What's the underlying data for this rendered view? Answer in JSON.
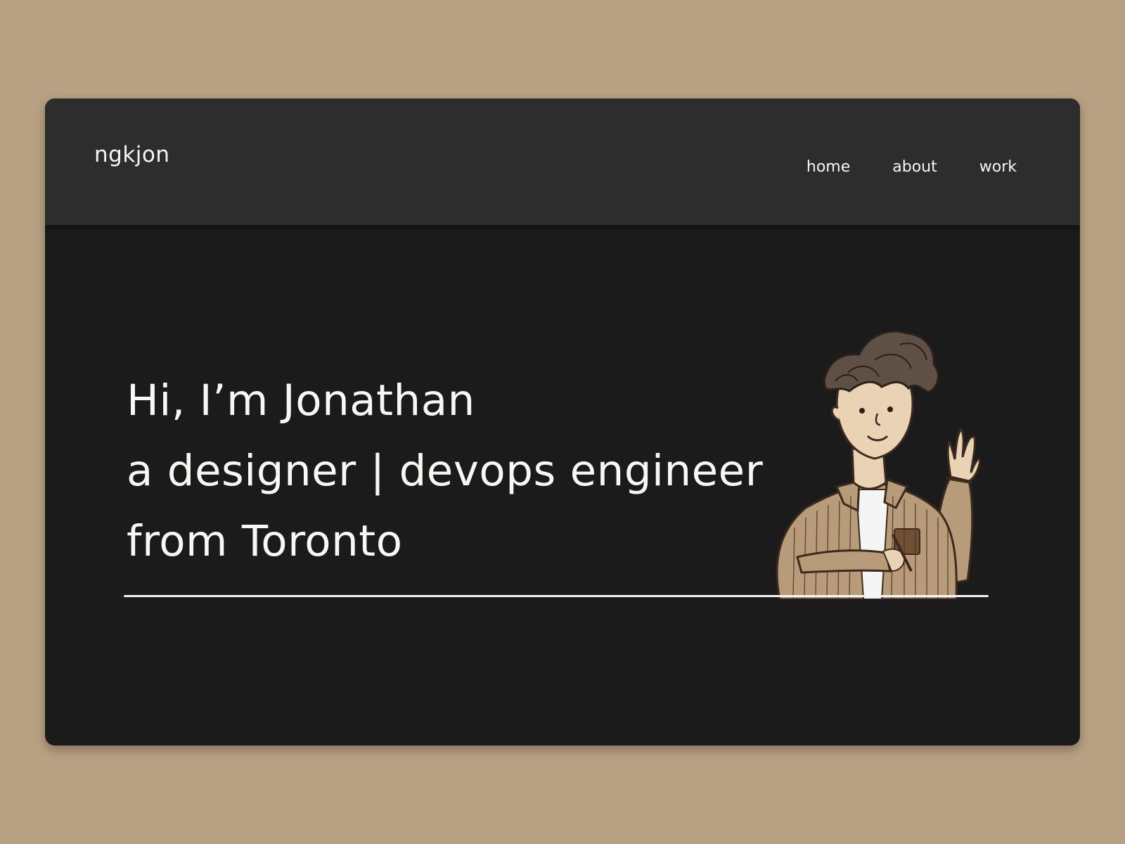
{
  "brand": {
    "name": "ngkjon"
  },
  "nav": {
    "items": [
      {
        "label": "home"
      },
      {
        "label": "about"
      },
      {
        "label": "work"
      }
    ]
  },
  "hero": {
    "line1": "Hi, I’m Jonathan",
    "line2": "a designer | devops engineer",
    "line3": "from Toronto"
  },
  "colors": {
    "page_background": "#b8a082",
    "window_background": "#1b1b1b",
    "navbar_background": "#2d2d2d",
    "text": "#f5f5f5",
    "jacket": "#b89b79"
  },
  "icons": {
    "avatar": "waving-person-illustration"
  }
}
